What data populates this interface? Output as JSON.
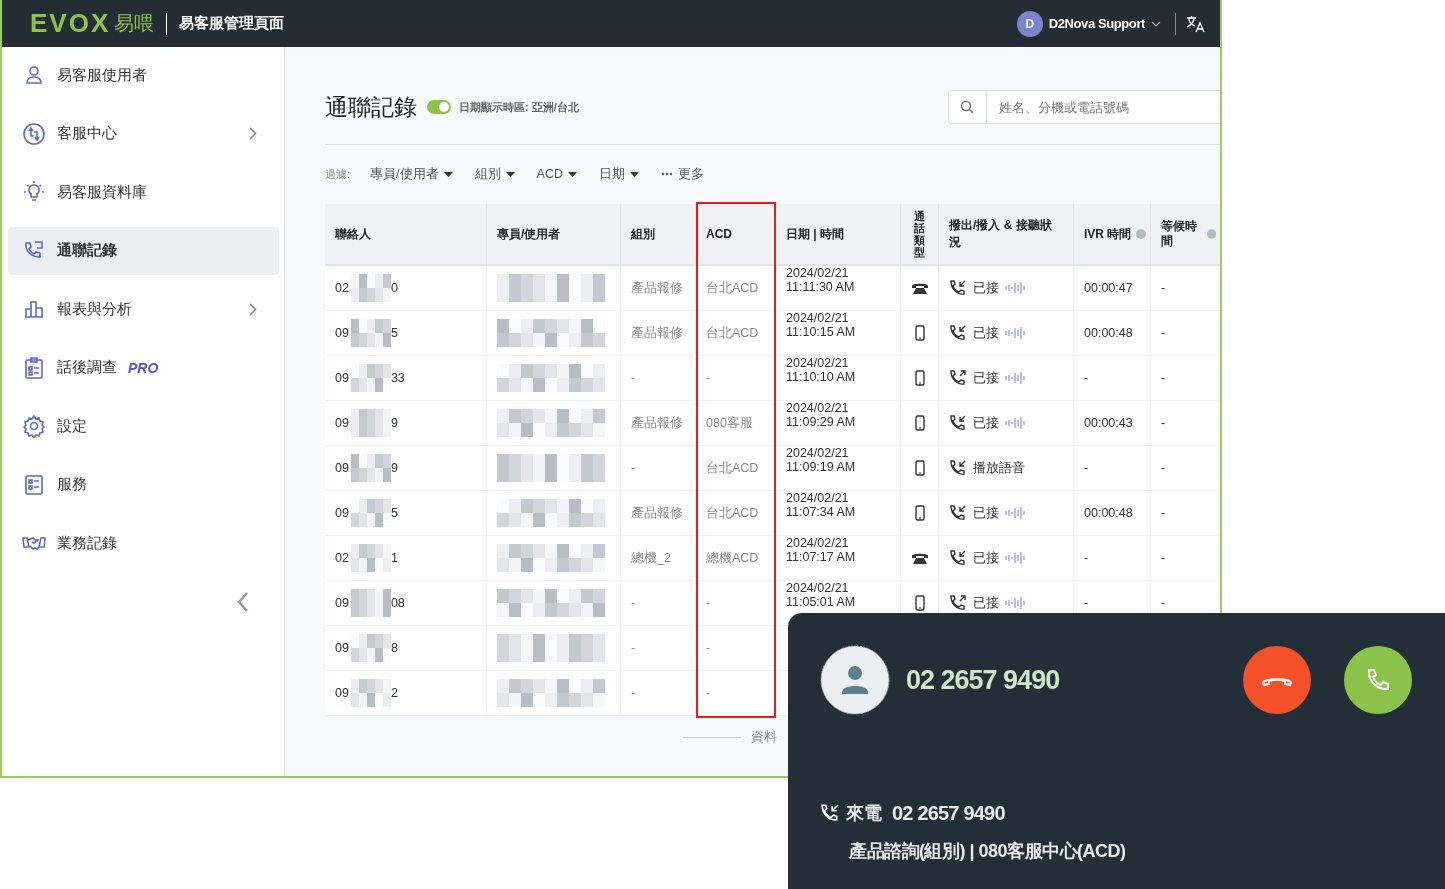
{
  "header": {
    "logo": "EVOX",
    "logo_sub": "易喂",
    "title": "易客服管理頁面",
    "user": {
      "initial": "D",
      "name": "D2Nova Support"
    }
  },
  "sidebar": {
    "items": [
      {
        "label": "易客服使用者",
        "submenu": false,
        "selected": false
      },
      {
        "label": "客服中心",
        "submenu": true,
        "selected": false
      },
      {
        "label": "易客服資料庫",
        "submenu": false,
        "selected": false
      },
      {
        "label": "通聯記錄",
        "submenu": false,
        "selected": true
      },
      {
        "label": "報表與分析",
        "submenu": true,
        "selected": false
      },
      {
        "label": "話後調查",
        "badge": "PRO",
        "submenu": false,
        "selected": false
      },
      {
        "label": "設定",
        "submenu": false,
        "selected": false
      },
      {
        "label": "服務",
        "submenu": false,
        "selected": false
      },
      {
        "label": "業務記錄",
        "submenu": false,
        "selected": false
      }
    ]
  },
  "page": {
    "title": "通聯記錄",
    "timezone_toggle": {
      "on": true,
      "label": "日期顯示時區: 亞洲/台北"
    },
    "search": {
      "placeholder": "姓名、分機或電話號碼"
    },
    "filters": {
      "label": "過濾:",
      "items": [
        {
          "label": "專員/使用者",
          "kind": "dropdown"
        },
        {
          "label": "組別",
          "kind": "dropdown"
        },
        {
          "label": "ACD",
          "kind": "dropdown"
        },
        {
          "label": "日期",
          "kind": "dropdown"
        },
        {
          "label": "更多",
          "kind": "more"
        }
      ]
    }
  },
  "table": {
    "columns": [
      {
        "label": "聯絡人",
        "kind": "text",
        "highlighted": false
      },
      {
        "label": "專員/使用者",
        "kind": "text",
        "highlighted": false
      },
      {
        "label": "組別",
        "kind": "text",
        "highlighted": false
      },
      {
        "label": "ACD",
        "kind": "text",
        "highlighted": true
      },
      {
        "label": "日期 | 時間",
        "kind": "text",
        "highlighted": false
      },
      {
        "label": "通話類型",
        "kind": "vertical",
        "highlighted": false
      },
      {
        "label": "撥出/撥入 & 接聽狀況",
        "kind": "text",
        "highlighted": false
      },
      {
        "label": "IVR 時間",
        "kind": "info",
        "highlighted": false
      },
      {
        "label": "等候時間",
        "kind": "info",
        "highlighted": false
      }
    ],
    "rows": [
      {
        "contact_prefix": "02",
        "contact_suffix": "0",
        "group": "產品報修",
        "acd": "台北ACD",
        "date": "2024/02/21",
        "time": "11:11:30 AM",
        "mobile": false,
        "outgoing": false,
        "status": "已接",
        "recording": true,
        "ivr_time": "00:00:47",
        "wait_time": "-"
      },
      {
        "contact_prefix": "09",
        "contact_suffix": "5",
        "group": "產品報修",
        "acd": "台北ACD",
        "date": "2024/02/21",
        "time": "11:10:15 AM",
        "mobile": true,
        "outgoing": false,
        "status": "已接",
        "recording": true,
        "ivr_time": "00:00:48",
        "wait_time": "-"
      },
      {
        "contact_prefix": "09",
        "contact_suffix": "33",
        "group": "-",
        "acd": "-",
        "date": "2024/02/21",
        "time": "11:10:10 AM",
        "mobile": true,
        "outgoing": true,
        "status": "已接",
        "recording": true,
        "ivr_time": "-",
        "wait_time": "-"
      },
      {
        "contact_prefix": "09",
        "contact_suffix": "9",
        "group": "產品報修",
        "acd": "080客服",
        "date": "2024/02/21",
        "time": "11:09:29 AM",
        "mobile": true,
        "outgoing": false,
        "status": "已接",
        "recording": true,
        "ivr_time": "00:00:43",
        "wait_time": "-"
      },
      {
        "contact_prefix": "09",
        "contact_suffix": "9",
        "group": "-",
        "acd": "台北ACD",
        "date": "2024/02/21",
        "time": "11:09:19 AM",
        "mobile": true,
        "outgoing": false,
        "status": "播放語音",
        "recording": false,
        "ivr_time": "-",
        "wait_time": "-"
      },
      {
        "contact_prefix": "09",
        "contact_suffix": "5",
        "group": "產品報修",
        "acd": "台北ACD",
        "date": "2024/02/21",
        "time": "11:07:34 AM",
        "mobile": true,
        "outgoing": false,
        "status": "已接",
        "recording": true,
        "ivr_time": "00:00:48",
        "wait_time": "-"
      },
      {
        "contact_prefix": "02",
        "contact_suffix": "1",
        "group": "總機_2",
        "acd": "總機ACD",
        "date": "2024/02/21",
        "time": "11:07:17 AM",
        "mobile": false,
        "outgoing": false,
        "status": "已接",
        "recording": true,
        "ivr_time": "-",
        "wait_time": "-"
      },
      {
        "contact_prefix": "09",
        "contact_suffix": "08",
        "group": "-",
        "acd": "-",
        "date": "2024/02/21",
        "time": "11:05:01 AM",
        "mobile": true,
        "outgoing": true,
        "status": "已接",
        "recording": true,
        "ivr_time": "-",
        "wait_time": "-"
      },
      {
        "contact_prefix": "09",
        "contact_suffix": "8",
        "group": "-",
        "acd": "-"
      },
      {
        "contact_prefix": "09",
        "contact_suffix": "2",
        "group": "-",
        "acd": "-"
      }
    ]
  },
  "footer": {
    "text": "資料"
  },
  "incoming_call": {
    "number": "02 2657 9490",
    "direction_label": "來電",
    "caller": "02 2657 9490",
    "route": "產品諮詢(組別) | 080客服中心(ACD)"
  }
}
